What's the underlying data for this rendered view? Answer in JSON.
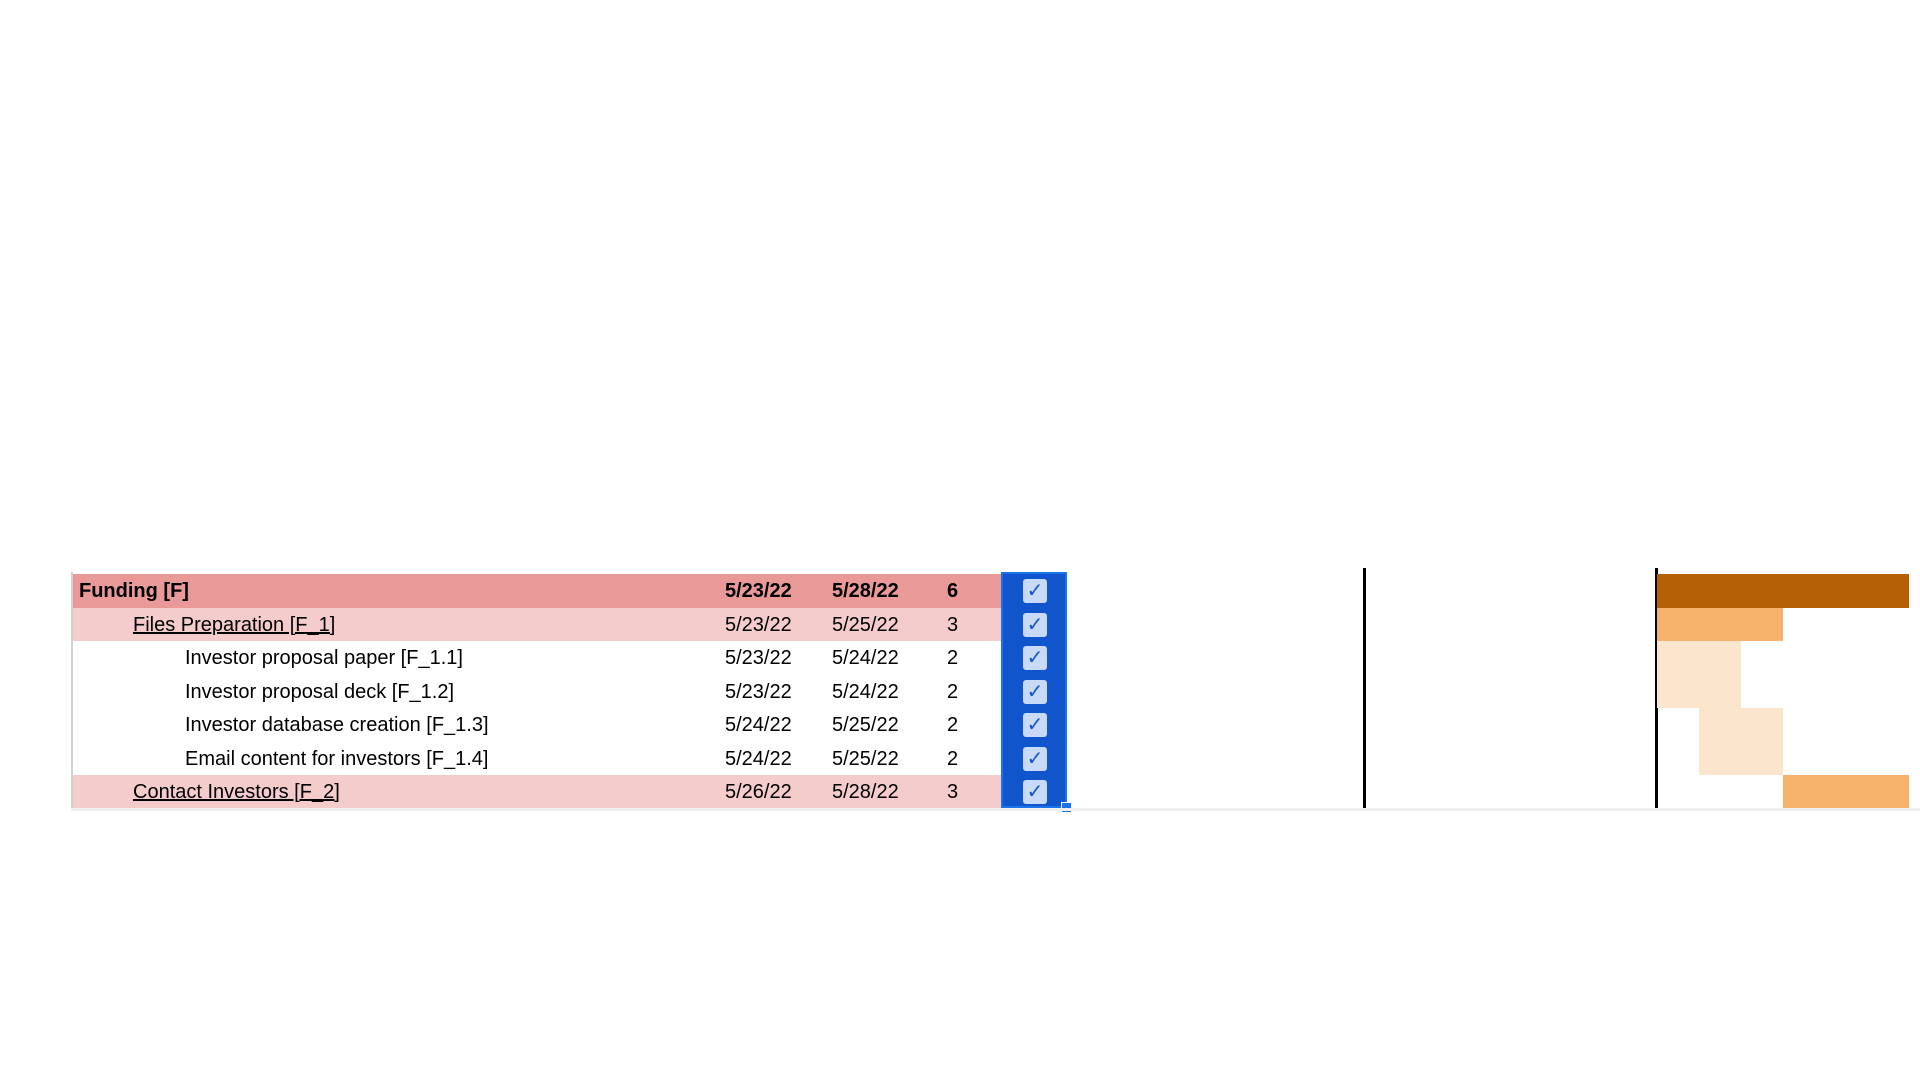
{
  "colors": {
    "level0": "#ea9999",
    "level1": "#f4cccc",
    "checkbox_col": "#1155cc",
    "bar_dark": "#b45f06",
    "bar_mid": "#f6b26b",
    "bar_light": "#fce5cd"
  },
  "timeline_start": "5/23/22",
  "rows": [
    {
      "name": "Funding [F]",
      "start": "5/23/22",
      "end": "5/28/22",
      "duration": "6",
      "done": true,
      "level": 0
    },
    {
      "name": "Files Preparation [F_1]",
      "start": "5/23/22",
      "end": "5/25/22",
      "duration": "3",
      "done": true,
      "level": 1
    },
    {
      "name": "Investor proposal paper [F_1.1]",
      "start": "5/23/22",
      "end": "5/24/22",
      "duration": "2",
      "done": true,
      "level": 2
    },
    {
      "name": "Investor proposal deck [F_1.2]",
      "start": "5/23/22",
      "end": "5/24/22",
      "duration": "2",
      "done": true,
      "level": 2
    },
    {
      "name": "Investor database creation [F_1.3]",
      "start": "5/24/22",
      "end": "5/25/22",
      "duration": "2",
      "done": true,
      "level": 2
    },
    {
      "name": "Email content for investors [F_1.4]",
      "start": "5/24/22",
      "end": "5/25/22",
      "duration": "2",
      "done": true,
      "level": 2
    },
    {
      "name": "Contact Investors [F_2]",
      "start": "5/26/22",
      "end": "5/28/22",
      "duration": "3",
      "done": true,
      "level": 1
    }
  ]
}
